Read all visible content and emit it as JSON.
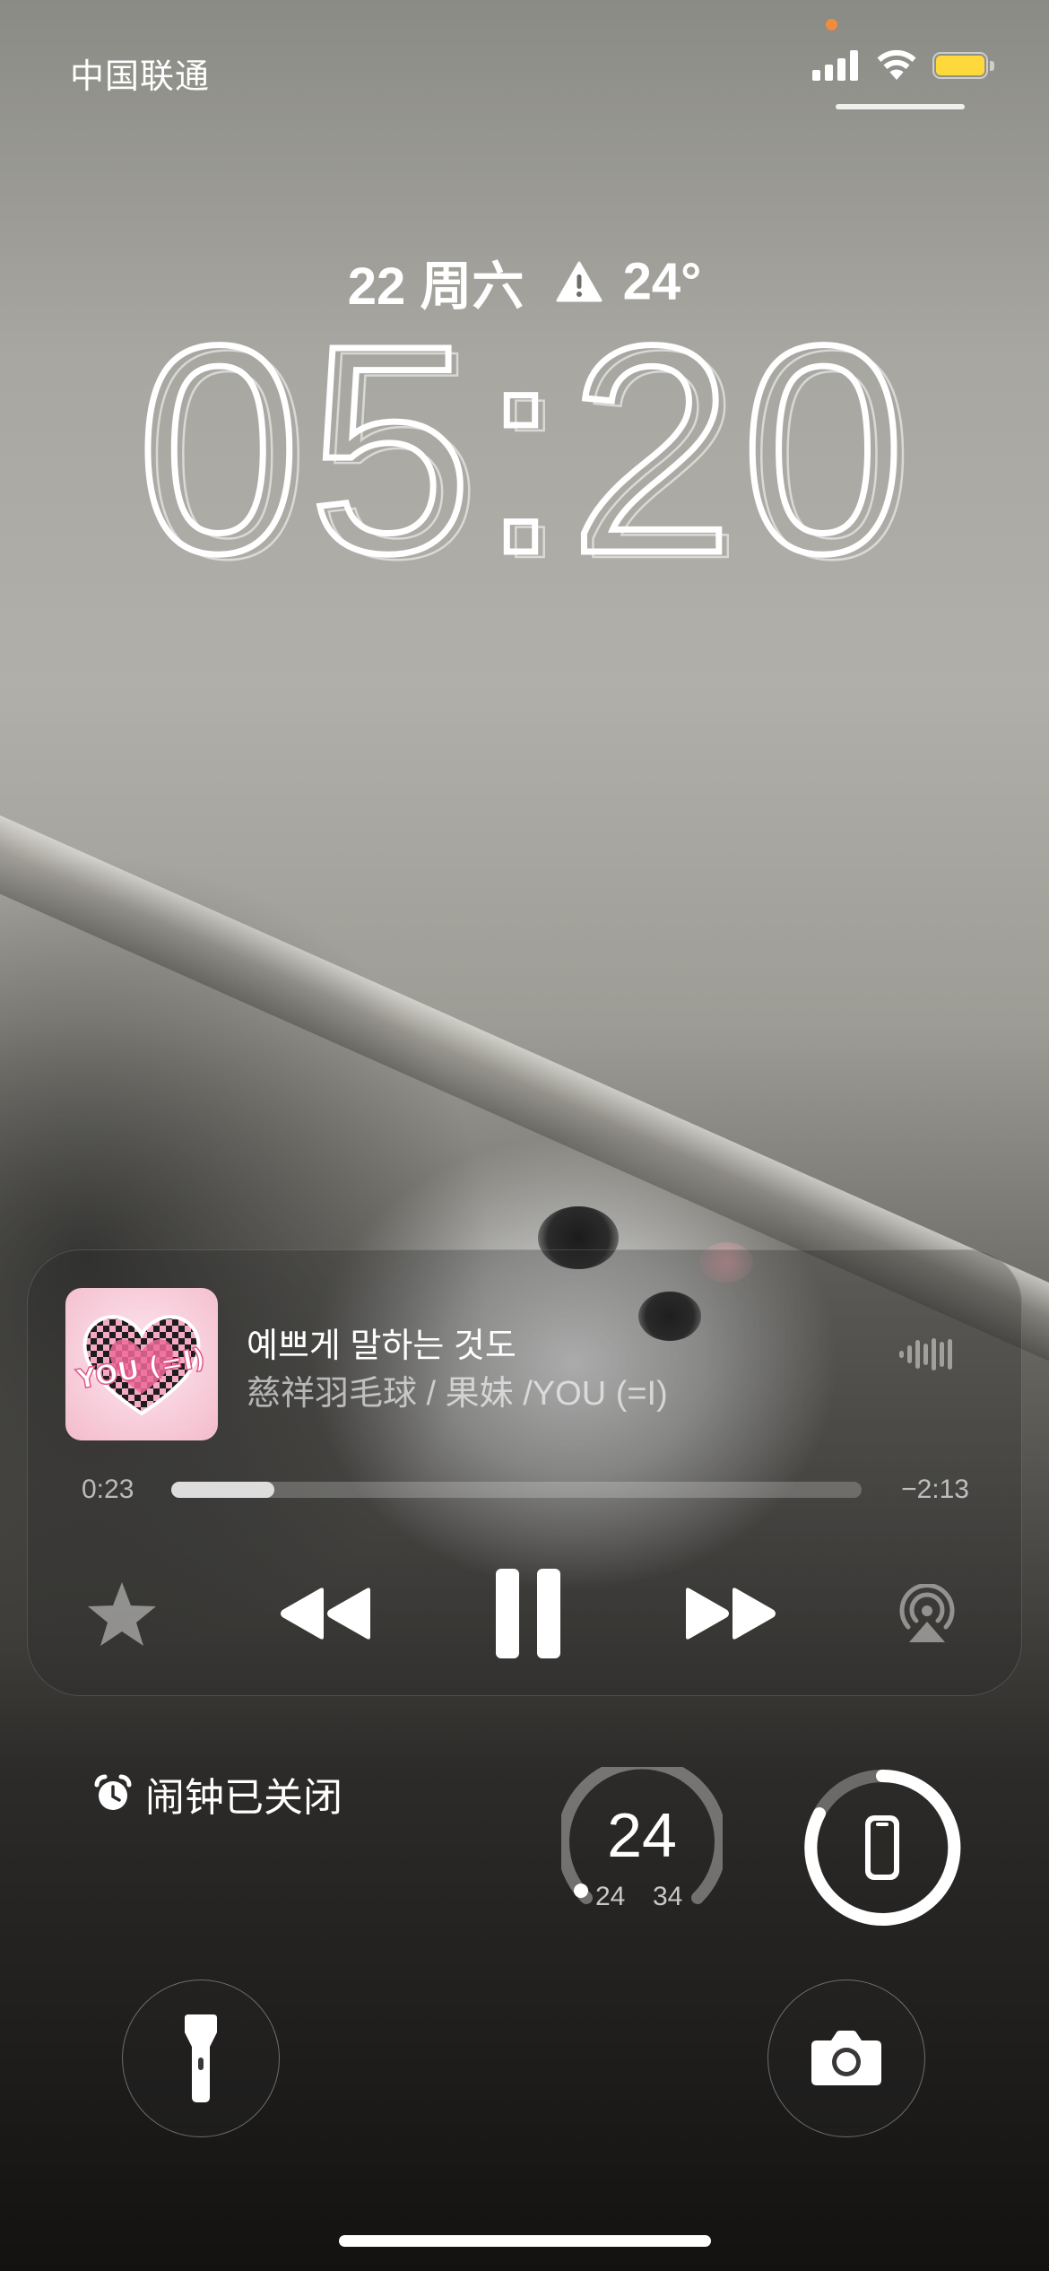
{
  "status_bar": {
    "carrier": "中国联通",
    "signal_icon": "cellular-signal-icon",
    "wifi_icon": "wifi-icon",
    "battery_icon": "battery-icon",
    "battery_color": "#ffd93b",
    "mic_indicator_color": "#f08c3c"
  },
  "lock_screen": {
    "date": "22 周六",
    "weather_icon": "warning-triangle-icon",
    "temperature": "24°",
    "time": "05:20"
  },
  "now_playing": {
    "title": "예쁘게 말하는 것도",
    "subtitle": "慈祥羽毛球 / 果妹 /YOU (=I)",
    "artwork_text": "YOU (=I)",
    "elapsed": "0:23",
    "remaining": "−2:13",
    "progress_fraction": 0.149,
    "controls": [
      "favorite-star-icon",
      "rewind-icon",
      "pause-icon",
      "fast-forward-icon",
      "airplay-icon"
    ]
  },
  "widgets": {
    "alarm_label": "闹钟已关闭",
    "alarm_icon": "alarm-clock-icon",
    "temperature_current": "24",
    "temperature_low": "24",
    "temperature_high": "34",
    "device_battery_icon": "iphone-icon"
  },
  "quick_actions": {
    "left": "flashlight-icon",
    "right": "camera-icon"
  }
}
